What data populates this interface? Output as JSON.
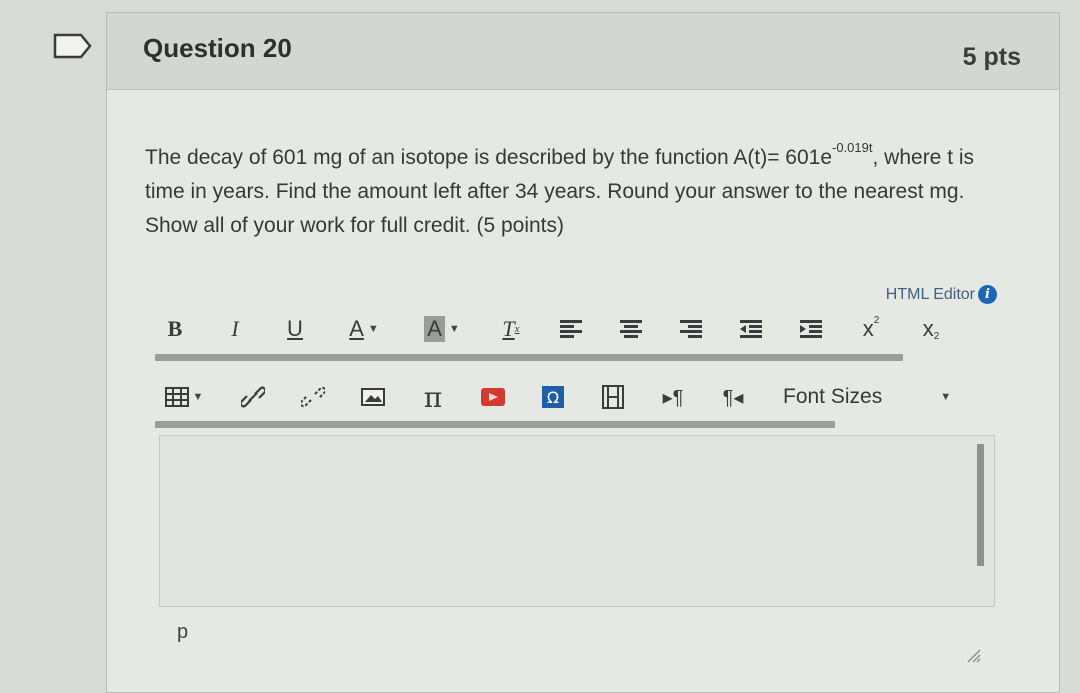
{
  "question": {
    "title": "Question 20",
    "points": "5 pts",
    "text_part1": "The decay of 601 mg of an isotope is described by the function A(t)= 601e",
    "exponent": "-0.019t",
    "text_part2": ", where t is time in years. Find the amount left after 34 years. Round your answer to the nearest mg. Show all of your work for full credit. (5 points)"
  },
  "editor": {
    "html_editor_label": "HTML Editor",
    "info_icon_glyph": "i",
    "toolbar1": {
      "bold": "B",
      "italic": "I",
      "underline": "U",
      "text_color": "A",
      "background_color": "A",
      "clear_format": "T",
      "superscript": "x",
      "subscript": "x"
    },
    "toolbar2": {
      "font_sizes": "Font Sizes"
    },
    "status_path": "p",
    "icons": [
      "table-icon",
      "link-icon",
      "unlink-icon",
      "image-icon",
      "math-pi-icon",
      "media-icon",
      "omega-icon",
      "film-icon",
      "ltr-pilcrow-icon",
      "rtl-pilcrow-icon",
      "resize-grip-icon",
      "bookmark-flag-icon"
    ]
  }
}
